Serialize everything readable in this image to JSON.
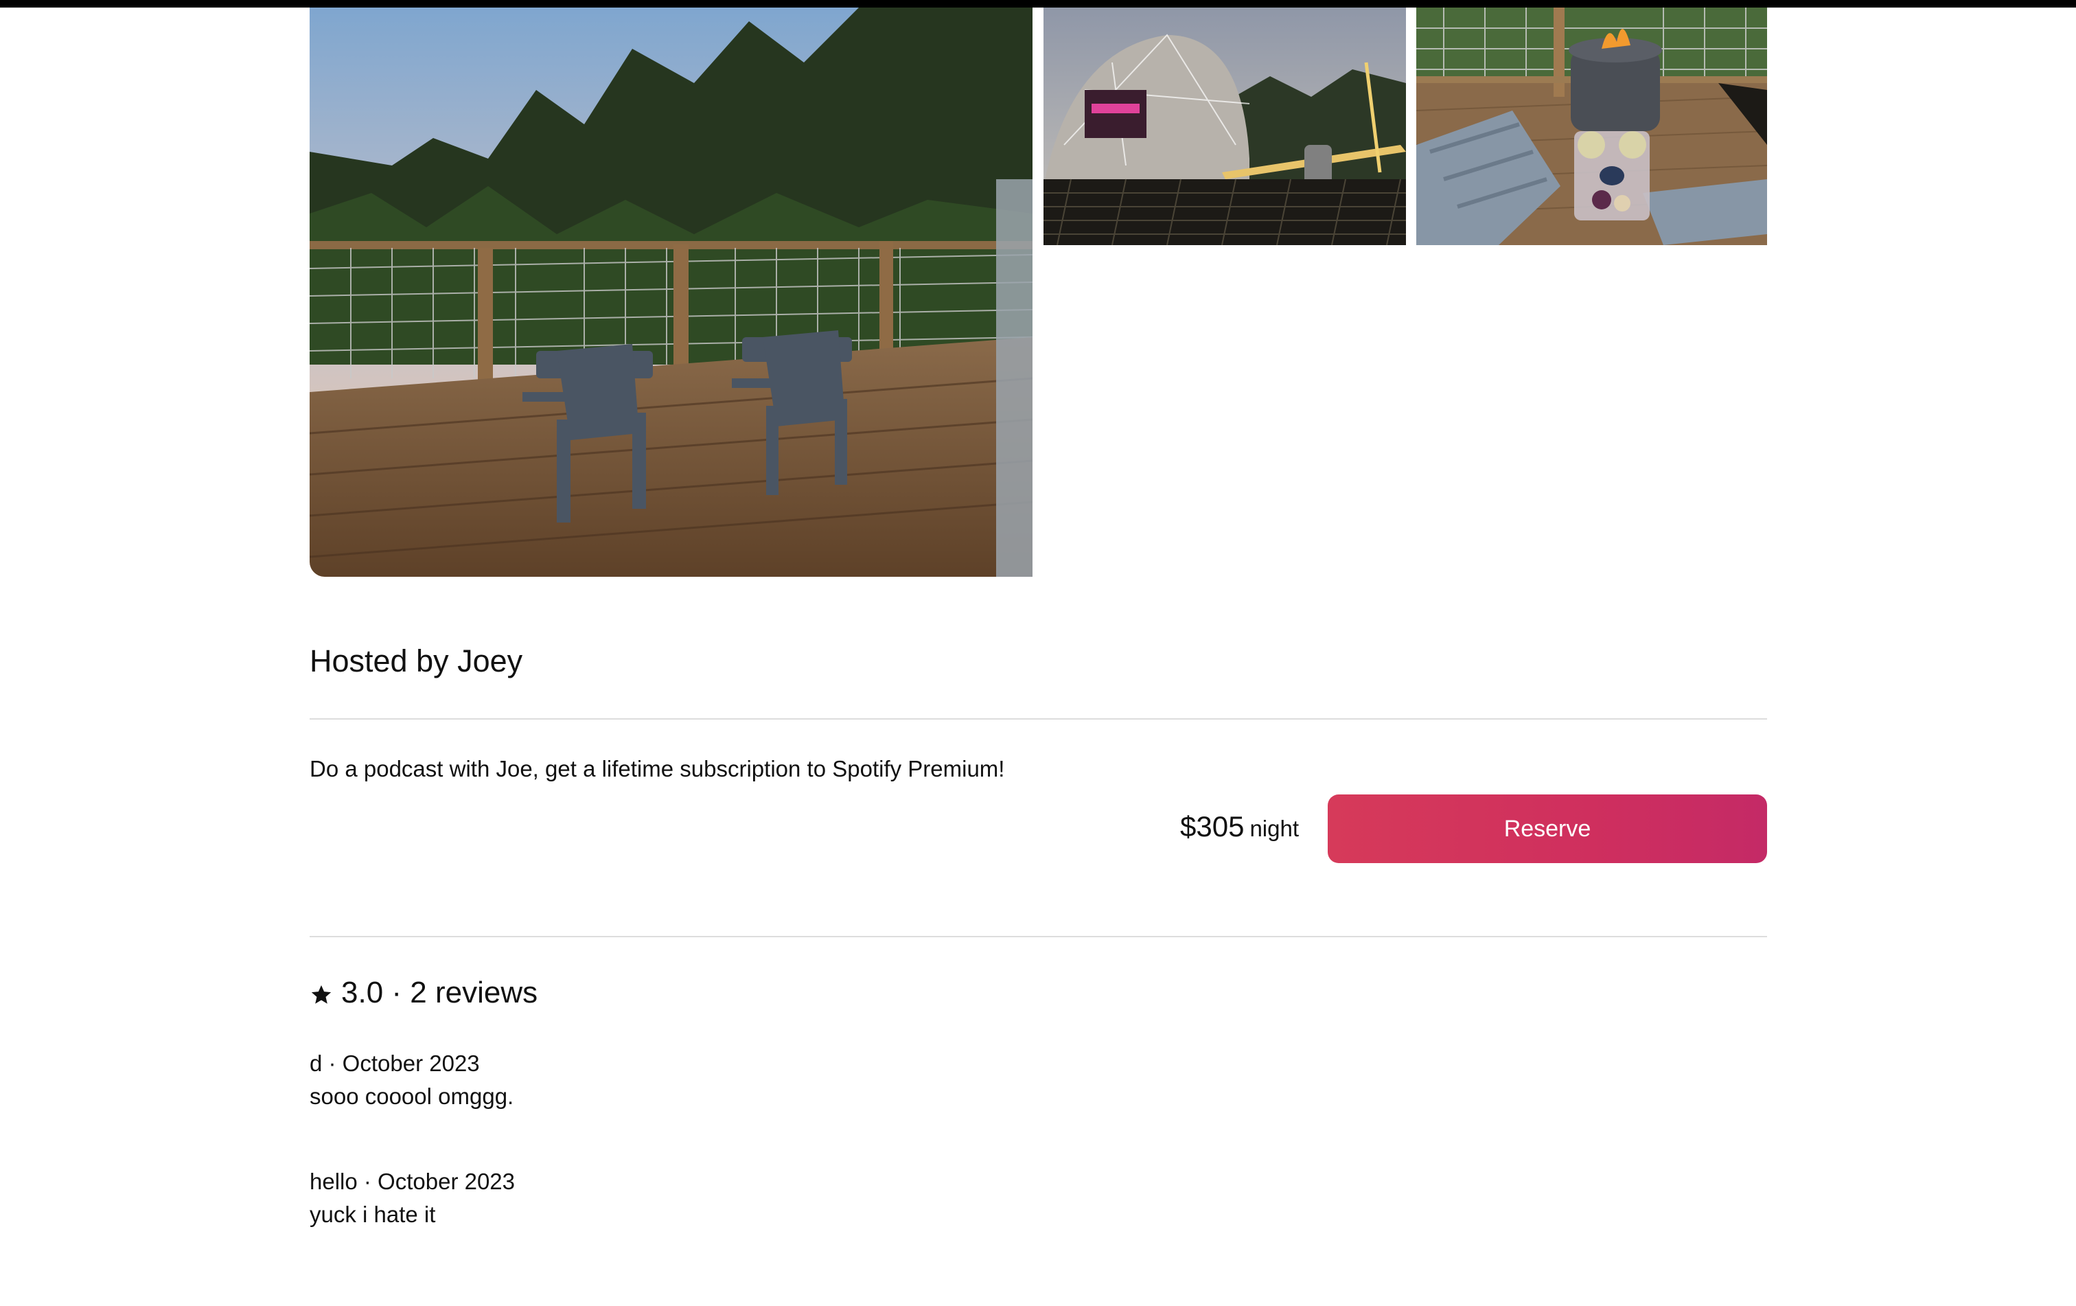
{
  "listing": {
    "host_title": "Hosted by Joey",
    "description": "Do a podcast with Joe, get a lifetime subscription to Spotify Premium!",
    "price": "$305",
    "price_unit": "night",
    "reserve_label": "Reserve"
  },
  "rating": {
    "text": "3.0 · 2 reviews"
  },
  "reviews": [
    {
      "meta": "d · October 2023",
      "body": "sooo cooool omggg."
    },
    {
      "meta": "hello · October 2023",
      "body": "yuck i hate it"
    }
  ],
  "colors": {
    "accent": "#d63a5a",
    "accent_end": "#c42a66",
    "divider": "#dddddd",
    "text": "#111111"
  },
  "icons": {
    "rating": "star-icon"
  }
}
